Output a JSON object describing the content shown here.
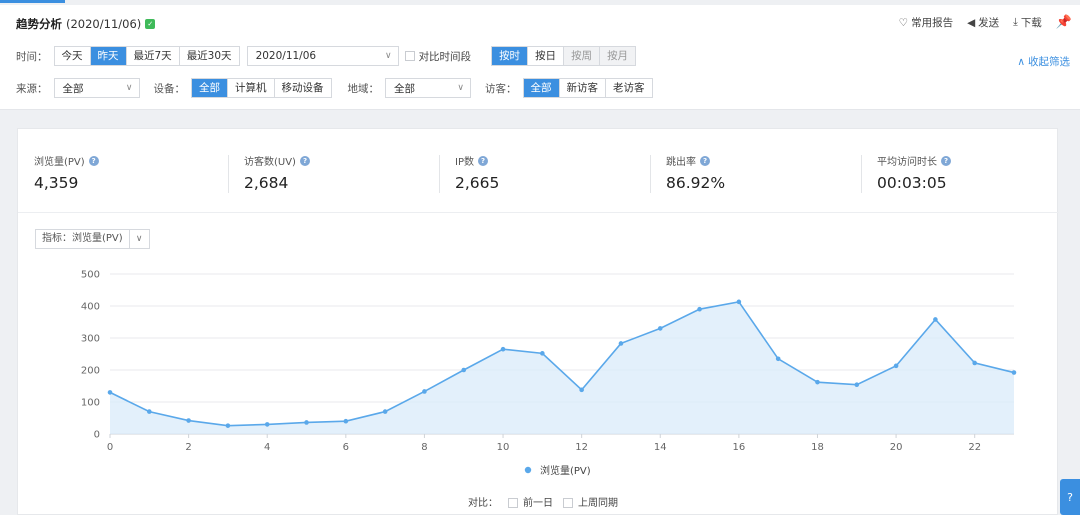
{
  "header": {
    "title": "趋势分析",
    "date": "(2020/11/06)",
    "badge_icon": "check-badge-icon",
    "actions": [
      {
        "icon": "heart-icon",
        "label": "常用报告"
      },
      {
        "icon": "send-icon",
        "label": "发送"
      },
      {
        "icon": "download-icon",
        "label": "下载"
      }
    ],
    "pin_icon": "pin-icon"
  },
  "filters": {
    "time_label": "时间：",
    "time_options": [
      "今天",
      "昨天",
      "最近7天",
      "最近30天"
    ],
    "time_active": "昨天",
    "date_value": "2020/11/06",
    "compare_period_label": "对比时间段",
    "granularity": [
      "按时",
      "按日",
      "按周",
      "按月"
    ],
    "granularity_active": "按时",
    "collapse_label": "收起筛选",
    "source_label": "来源：",
    "source_value": "全部",
    "device_label": "设备：",
    "device_options": [
      "全部",
      "计算机",
      "移动设备"
    ],
    "device_active": "全部",
    "region_label": "地域：",
    "region_value": "全部",
    "visitor_label": "访客：",
    "visitor_options": [
      "全部",
      "新访客",
      "老访客"
    ],
    "visitor_active": "全部"
  },
  "metrics": [
    {
      "label": "浏览量(PV)",
      "value": "4,359"
    },
    {
      "label": "访客数(UV)",
      "value": "2,684"
    },
    {
      "label": "IP数",
      "value": "2,665"
    },
    {
      "label": "跳出率",
      "value": "86.92%"
    },
    {
      "label": "平均访问时长",
      "value": "00:03:05"
    }
  ],
  "indicator": {
    "label": "指标：",
    "value": "浏览量(PV)"
  },
  "compare": {
    "label": "对比：",
    "options": [
      "前一日",
      "上周同期"
    ]
  },
  "colors": {
    "accent": "#3b8fe0",
    "series": "#5aa8ea",
    "fill": "#d9ebfa"
  },
  "chart_data": {
    "type": "area",
    "x": [
      0,
      1,
      2,
      3,
      4,
      5,
      6,
      7,
      8,
      9,
      10,
      11,
      12,
      13,
      14,
      15,
      16,
      17,
      18,
      19,
      20,
      21,
      22,
      23
    ],
    "xticks": [
      0,
      2,
      4,
      6,
      8,
      10,
      12,
      14,
      16,
      18,
      20,
      22
    ],
    "yticks": [
      0,
      100,
      200,
      300,
      400,
      500
    ],
    "ylim": [
      0,
      500
    ],
    "series": [
      {
        "name": "浏览量(PV)",
        "values": [
          130,
          70,
          42,
          26,
          30,
          36,
          40,
          70,
          133,
          200,
          265,
          252,
          138,
          283,
          330,
          390,
          413,
          235,
          162,
          154,
          213,
          358,
          222,
          192
        ]
      }
    ],
    "legend": "bottom",
    "grid": true
  }
}
